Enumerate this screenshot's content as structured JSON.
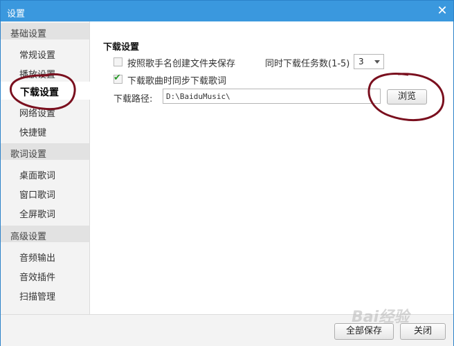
{
  "window": {
    "title": "设置",
    "close_symbol": "✕"
  },
  "sidebar": {
    "groups": [
      {
        "header": "基础设置",
        "items": [
          {
            "label": "常规设置"
          },
          {
            "label": "播放设置"
          },
          {
            "label": "下载设置",
            "active": true
          },
          {
            "label": "网络设置"
          },
          {
            "label": "快捷键"
          }
        ]
      },
      {
        "header": "歌词设置",
        "items": [
          {
            "label": "桌面歌词"
          },
          {
            "label": "窗口歌词"
          },
          {
            "label": "全屏歌词"
          }
        ]
      },
      {
        "header": "高级设置",
        "items": [
          {
            "label": "音频输出"
          },
          {
            "label": "音效插件"
          },
          {
            "label": "扫描管理"
          }
        ]
      }
    ]
  },
  "download": {
    "section_title": "下载设置",
    "create_folder_label": "按照歌手名创建文件夹保存",
    "create_folder_checked": false,
    "sync_lyrics_label": "下载歌曲时同步下载歌词",
    "sync_lyrics_checked": true,
    "concurrent_label": "同时下载任务数(1-5)",
    "concurrent_value": "3",
    "path_label": "下载路径:",
    "path_value": "D:\\BaiduMusic\\",
    "browse_label": "浏览"
  },
  "footer": {
    "save_all_label": "全部保存",
    "close_label": "关闭"
  },
  "watermark": "Bai经验",
  "colors": {
    "titlebar": "#3a98de",
    "annotation": "#7a0f1e",
    "check": "#2a9a2a"
  }
}
